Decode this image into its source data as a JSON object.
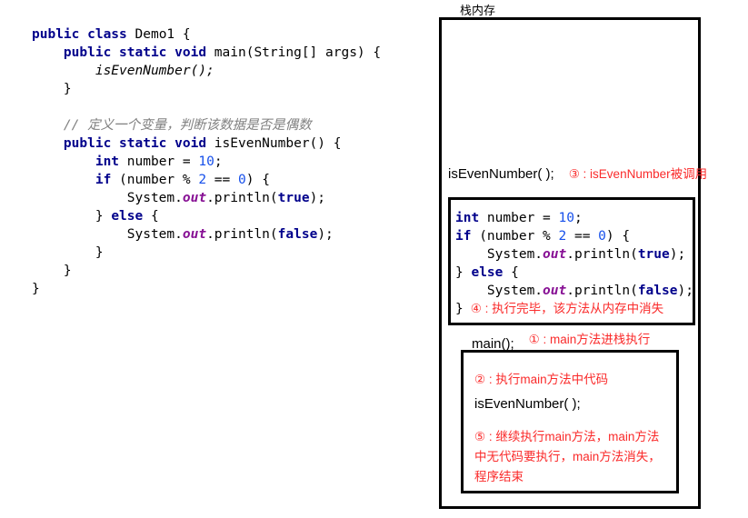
{
  "stack_title": "栈内存",
  "colors": {
    "keyword_navy": "#00008b",
    "number_blue": "#1750eb",
    "field_purple": "#871094",
    "comment_gray": "#808080",
    "annotation_red": "#fa2b2b",
    "border_black": "#000000"
  },
  "left_code": {
    "lines": [
      [
        {
          "t": "public class ",
          "c": "kw"
        },
        {
          "t": "Demo1 {"
        }
      ],
      [
        {
          "t": "    "
        },
        {
          "t": "public static void ",
          "c": "kw"
        },
        {
          "t": "main(String[] args) {"
        }
      ],
      [
        {
          "t": "        "
        },
        {
          "t": "isEvenNumber();",
          "c": "it"
        }
      ],
      [
        {
          "t": "    }"
        }
      ],
      [
        {
          "t": " "
        }
      ],
      [
        {
          "t": "    "
        },
        {
          "t": "// 定义一个变量，判断该数据是否是偶数",
          "c": "cm"
        }
      ],
      [
        {
          "t": "    "
        },
        {
          "t": "public static void ",
          "c": "kw"
        },
        {
          "t": "isEvenNumber() {"
        }
      ],
      [
        {
          "t": "        "
        },
        {
          "t": "int",
          "c": "kw"
        },
        {
          "t": " number = "
        },
        {
          "t": "10",
          "c": "num"
        },
        {
          "t": ";"
        }
      ],
      [
        {
          "t": "        "
        },
        {
          "t": "if",
          "c": "kw"
        },
        {
          "t": " (number % "
        },
        {
          "t": "2",
          "c": "num"
        },
        {
          "t": " == "
        },
        {
          "t": "0",
          "c": "num"
        },
        {
          "t": ") {"
        }
      ],
      [
        {
          "t": "            System."
        },
        {
          "t": "out",
          "c": "fld"
        },
        {
          "t": ".println("
        },
        {
          "t": "true",
          "c": "kw"
        },
        {
          "t": ");"
        }
      ],
      [
        {
          "t": "        } "
        },
        {
          "t": "else",
          "c": "kw"
        },
        {
          "t": " {"
        }
      ],
      [
        {
          "t": "            System."
        },
        {
          "t": "out",
          "c": "fld"
        },
        {
          "t": ".println("
        },
        {
          "t": "false",
          "c": "kw"
        },
        {
          "t": ");"
        }
      ],
      [
        {
          "t": "        }"
        }
      ],
      [
        {
          "t": "    }"
        }
      ],
      [
        {
          "t": "}"
        }
      ]
    ]
  },
  "stack": {
    "call_line": {
      "code": "isEvenNumber( );",
      "annotation": "③ : isEvenNumber被调用"
    },
    "even_frame": {
      "code_lines": [
        [
          {
            "t": "int",
            "c": "kw"
          },
          {
            "t": " number = "
          },
          {
            "t": "10",
            "c": "num"
          },
          {
            "t": ";"
          }
        ],
        [
          {
            "t": "if",
            "c": "kw"
          },
          {
            "t": " (number % "
          },
          {
            "t": "2",
            "c": "num"
          },
          {
            "t": " == "
          },
          {
            "t": "0",
            "c": "num"
          },
          {
            "t": ") {"
          }
        ],
        [
          {
            "t": "    System."
          },
          {
            "t": "out",
            "c": "fld"
          },
          {
            "t": ".println("
          },
          {
            "t": "true",
            "c": "kw"
          },
          {
            "t": ");"
          }
        ],
        [
          {
            "t": "} "
          },
          {
            "t": "else",
            "c": "kw"
          },
          {
            "t": " {"
          }
        ],
        [
          {
            "t": "    System."
          },
          {
            "t": "out",
            "c": "fld"
          },
          {
            "t": ".println("
          },
          {
            "t": "false",
            "c": "kw"
          },
          {
            "t": ");"
          }
        ],
        [
          {
            "t": "}"
          },
          {
            "t": "④ : 执行完毕，该方法从内存中消失",
            "c": "ann"
          }
        ]
      ]
    },
    "main_line": {
      "code": "main();",
      "annotation": "① : main方法进栈执行"
    },
    "main_frame": {
      "annotation_2": "② : 执行main方法中代码",
      "call": "isEvenNumber( );",
      "annotation_5": "⑤ : 继续执行main方法，main方法中无代码要执行，main方法消失，程序结束"
    }
  }
}
